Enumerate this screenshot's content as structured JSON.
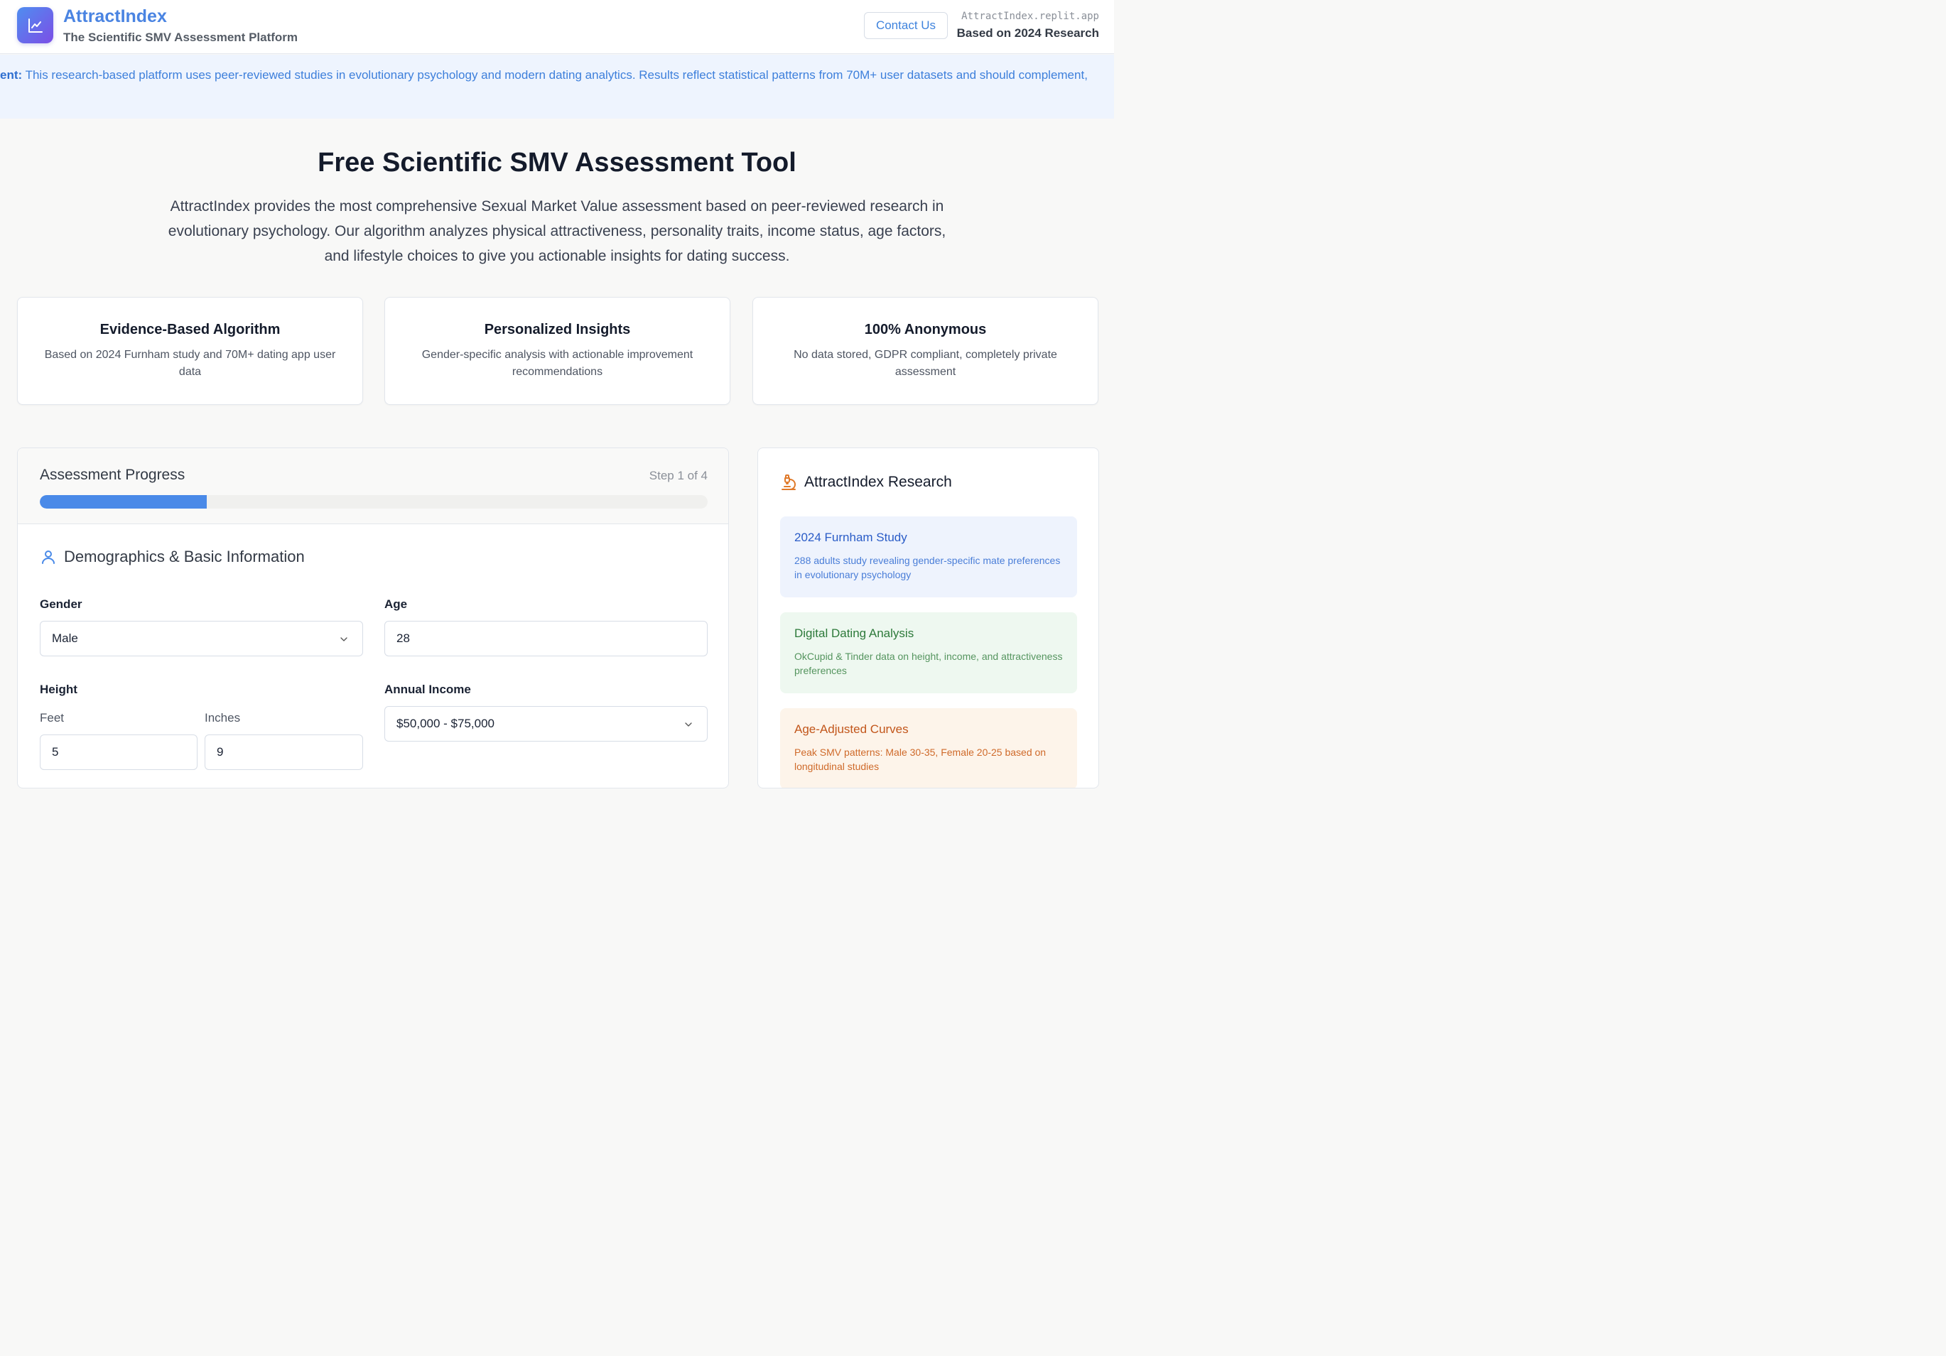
{
  "header": {
    "brand_title": "AttractIndex",
    "brand_subtitle": "The Scientific SMV Assessment Platform",
    "contact_label": "Contact Us",
    "site_url": "AttractIndex.replit.app",
    "research_year": "Based on 2024 Research"
  },
  "banner": {
    "label": "ent:",
    "text": " This research-based platform uses peer-reviewed studies in evolutionary psychology and modern dating analytics. Results reflect statistical patterns from 70M+ user datasets and should complement,"
  },
  "hero": {
    "title": "Free Scientific SMV Assessment Tool",
    "description": "AttractIndex provides the most comprehensive Sexual Market Value assessment based on peer-reviewed research in evolutionary psychology. Our algorithm analyzes physical attractiveness, personality traits, income status, age factors, and lifestyle choices to give you actionable insights for dating success."
  },
  "features": [
    {
      "title": "Evidence-Based Algorithm",
      "text": "Based on 2024 Furnham study and 70M+ dating app user data"
    },
    {
      "title": "Personalized Insights",
      "text": "Gender-specific analysis with actionable improvement recommendations"
    },
    {
      "title": "100% Anonymous",
      "text": "No data stored, GDPR compliant, completely private assessment"
    }
  ],
  "assessment": {
    "progress_title": "Assessment Progress",
    "step_label": "Step 1 of 4",
    "progress_fraction": 0.25,
    "section_title": "Demographics & Basic Information",
    "gender_label": "Gender",
    "gender_value": "Male",
    "age_label": "Age",
    "age_value": "28",
    "height_label": "Height",
    "feet_label": "Feet",
    "feet_value": "5",
    "inches_label": "Inches",
    "inches_value": "9",
    "income_label": "Annual Income",
    "income_value": "$50,000 - $75,000"
  },
  "research": {
    "title": "AttractIndex Research",
    "cards": [
      {
        "title": "2024 Furnham Study",
        "text": "288 adults study revealing gender-specific mate preferences in evolutionary psychology"
      },
      {
        "title": "Digital Dating Analysis",
        "text": "OkCupid & Tinder data on height, income, and attractiveness preferences"
      },
      {
        "title": "Age-Adjusted Curves",
        "text": "Peak SMV patterns: Male 30-35, Female 20-25 based on longitudinal studies"
      }
    ]
  },
  "colors": {
    "accent": "#4a8ae8",
    "brand_gradient_start": "#4f8ef0",
    "brand_gradient_end": "#7c4ee6"
  }
}
